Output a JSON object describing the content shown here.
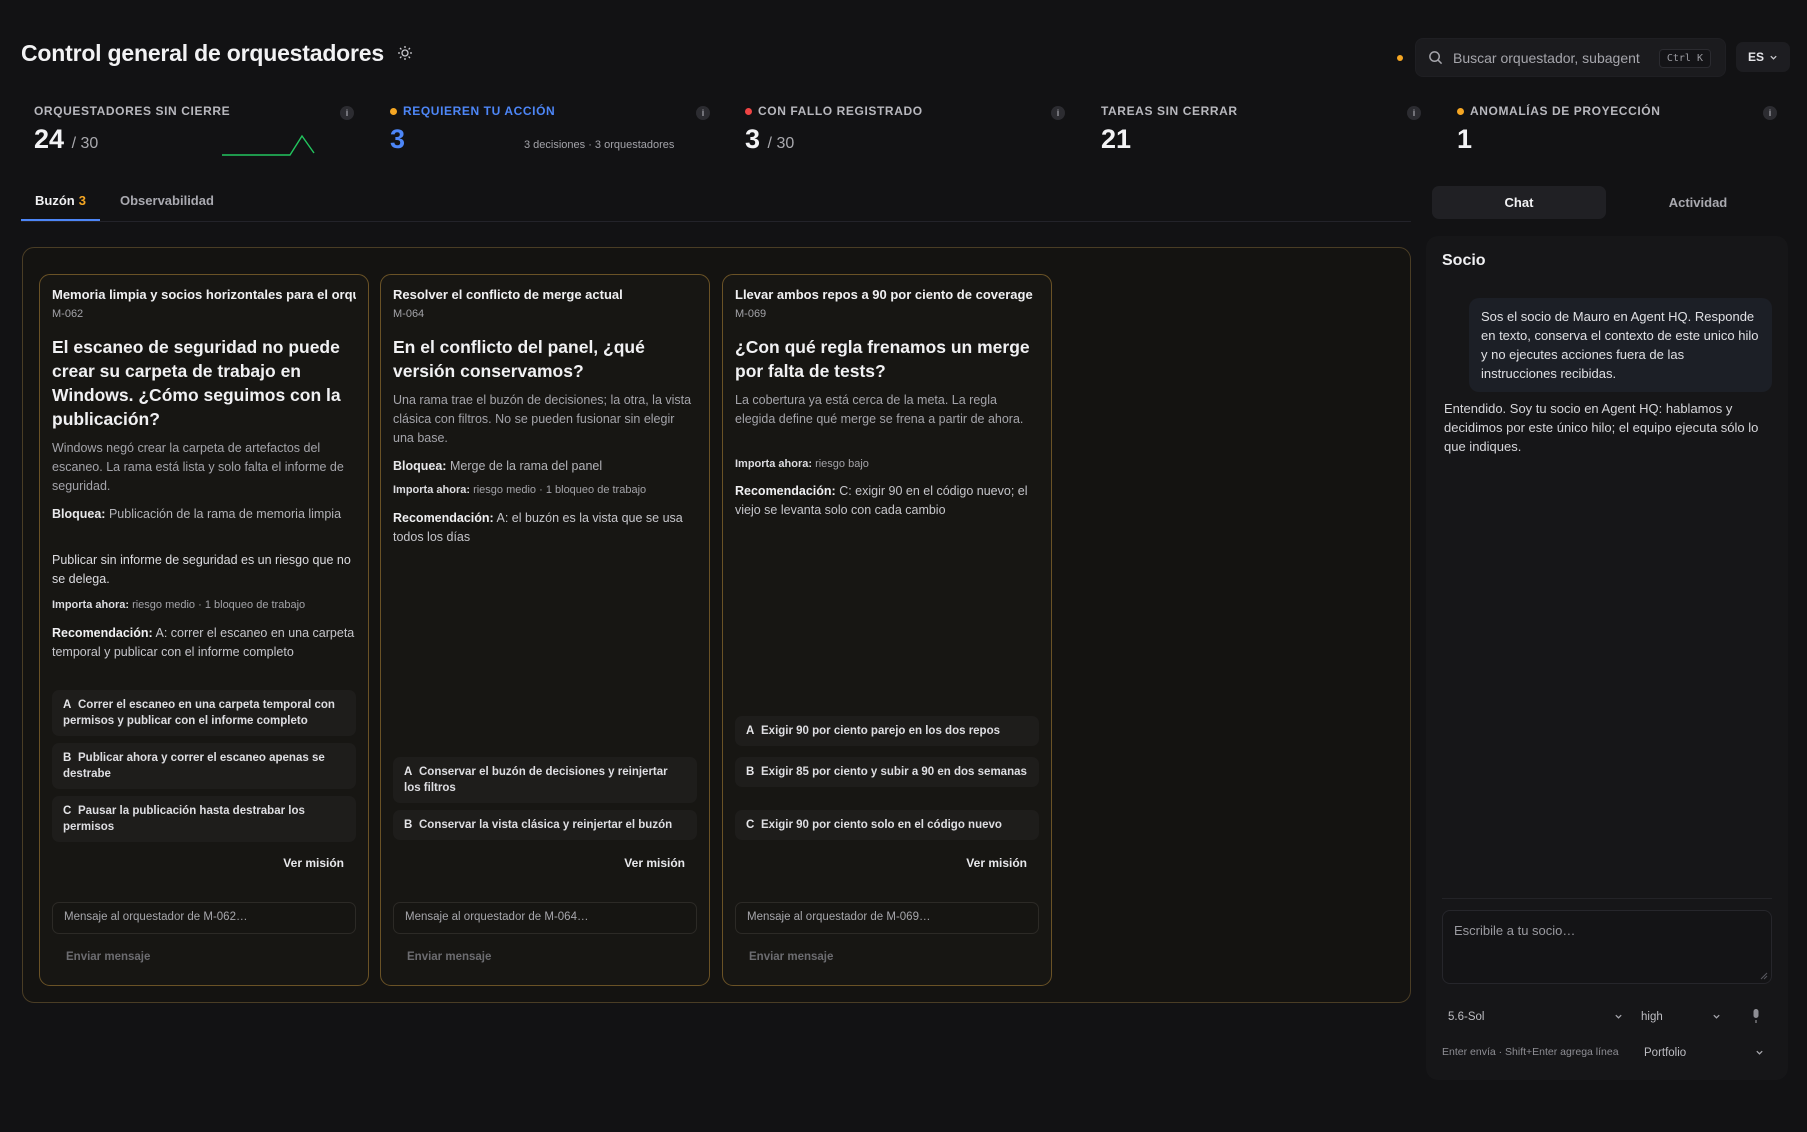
{
  "header": {
    "title": "Control general de orquestadores",
    "search_placeholder": "Buscar orquestador, subagent",
    "search_shortcut": "Ctrl K",
    "language": "ES"
  },
  "stats": [
    {
      "label": "ORQUESTADORES SIN CIERRE",
      "value": "24",
      "denominator": "/ 30",
      "dot_color": null
    },
    {
      "label": "REQUIEREN TU ACCIÓN",
      "value": "3",
      "sub": "3 decisiones · 3 orquestadores",
      "dot_color": "#f5a623",
      "label_color": "#4d86f7",
      "value_color": "#4d86f7"
    },
    {
      "label": "CON FALLO REGISTRADO",
      "value": "3",
      "denominator": "/ 30",
      "dot_color": "#ef4444"
    },
    {
      "label": "TAREAS SIN CERRAR",
      "value": "21",
      "dot_color": null
    },
    {
      "label": "ANOMALÍAS DE PROYECCIÓN",
      "value": "1",
      "dot_color": "#f5a623"
    }
  ],
  "info_glyph": "i",
  "tabs": {
    "inbox_label": "Buzón",
    "inbox_count": "3",
    "observability_label": "Observabilidad"
  },
  "cards": [
    {
      "header": "Memoria limpia y socios horizontales para el orquestador",
      "id": "M-062",
      "question": "El escaneo de seguridad no puede crear su carpeta de trabajo en Windows. ¿Cómo seguimos con la publicación?",
      "body": "Windows negó crear la carpeta de artefactos del escaneo. La rama está lista y solo falta el informe de seguridad.",
      "blocks_label": "Bloquea:",
      "blocks": "Publicación de la rama de memoria limpia",
      "extra": "Publicar sin informe de seguridad es un riesgo que no se delega.",
      "importance_label": "Importa ahora:",
      "importance": "riesgo medio · 1 bloqueo de trabajo",
      "rec_label": "Recomendación:",
      "recommendation": "A: correr el escaneo en una carpeta temporal y publicar con el informe completo",
      "options": [
        {
          "key": "A",
          "text": "Correr el escaneo en una carpeta temporal con permisos y publicar con el informe completo"
        },
        {
          "key": "B",
          "text": "Publicar ahora y correr el escaneo apenas se destrabe"
        },
        {
          "key": "C",
          "text": "Pausar la publicación hasta destrabar los permisos"
        }
      ],
      "view_label": "Ver misión",
      "message_placeholder": "Mensaje al orquestador de M-062…",
      "send_label": "Enviar mensaje"
    },
    {
      "header": "Resolver el conflicto de merge actual",
      "id": "M-064",
      "question": "En el conflicto del panel, ¿qué versión conservamos?",
      "body": "Una rama trae el buzón de decisiones; la otra, la vista clásica con filtros. No se pueden fusionar sin elegir una base.",
      "blocks_label": "Bloquea:",
      "blocks": "Merge de la rama del panel",
      "importance_label": "Importa ahora:",
      "importance": "riesgo medio · 1 bloqueo de trabajo",
      "rec_label": "Recomendación:",
      "recommendation": "A: el buzón es la vista que se usa todos los días",
      "options": [
        {
          "key": "A",
          "text": "Conservar el buzón de decisiones y reinjertar los filtros"
        },
        {
          "key": "B",
          "text": "Conservar la vista clásica y reinjertar el buzón"
        }
      ],
      "view_label": "Ver misión",
      "message_placeholder": "Mensaje al orquestador de M-064…",
      "send_label": "Enviar mensaje"
    },
    {
      "header": "Llevar ambos repos a 90 por ciento de coverage",
      "id": "M-069",
      "question": "¿Con qué regla frenamos un merge por falta de tests?",
      "body": "La cobertura ya está cerca de la meta. La regla elegida define qué merge se frena a partir de ahora.",
      "importance_label": "Importa ahora:",
      "importance": "riesgo bajo",
      "rec_label": "Recomendación:",
      "recommendation": "C: exigir 90 en el código nuevo; el viejo se levanta solo con cada cambio",
      "options": [
        {
          "key": "A",
          "text": "Exigir 90 por ciento parejo en los dos repos"
        },
        {
          "key": "B",
          "text": "Exigir 85 por ciento y subir a 90 en dos semanas"
        },
        {
          "key": "C",
          "text": "Exigir 90 por ciento solo en el código nuevo"
        }
      ],
      "view_label": "Ver misión",
      "message_placeholder": "Mensaje al orquestador de M-069…",
      "send_label": "Enviar mensaje"
    }
  ],
  "side": {
    "chat_tab": "Chat",
    "activity_tab": "Actividad",
    "title": "Socio",
    "user_message": "Sos el socio de Mauro en Agent HQ. Responde en texto, conserva el contexto de este unico hilo y no ejecutes acciones fuera de las instrucciones recibidas.",
    "assistant_message": "Entendido. Soy tu socio en Agent HQ: hablamos y decidimos por este único hilo; el equipo ejecuta sólo lo que indiques.",
    "composer_placeholder": "Escribile a tu socio…",
    "model": "5.6-Sol",
    "effort": "high",
    "hint": "Enter envía · Shift+Enter agrega línea",
    "scope": "Portfolio"
  },
  "colors": {
    "accent": "#4d86f7",
    "warning": "#f5a623",
    "danger": "#ef4444",
    "card_border": "#6a5226"
  },
  "icons": [
    "sun-icon",
    "search-icon",
    "chevron-down-icon",
    "info-icon",
    "microphone-icon"
  ]
}
